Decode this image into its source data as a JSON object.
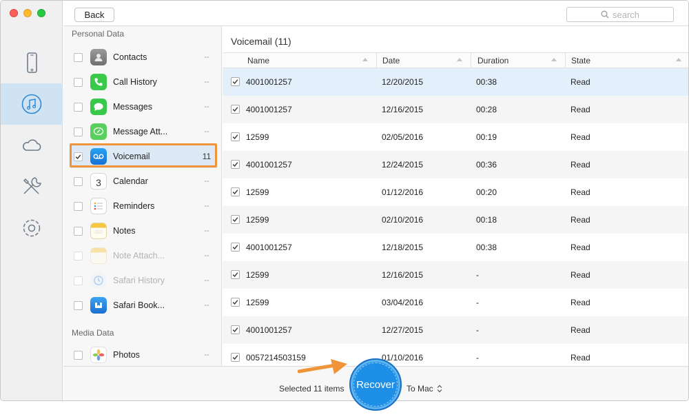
{
  "toolbar": {
    "back_label": "Back",
    "search_placeholder": "search"
  },
  "rail": {
    "items": [
      {
        "icon": "iphone-icon",
        "active": false
      },
      {
        "icon": "itunes-icon",
        "active": true
      },
      {
        "icon": "icloud-icon",
        "active": false
      },
      {
        "icon": "tools-icon",
        "active": false
      },
      {
        "icon": "gear-icon",
        "active": false
      }
    ]
  },
  "categories": {
    "personal_title": "Personal Data",
    "media_title": "Media Data",
    "items": [
      {
        "label": "Contacts",
        "count": "--",
        "icon": "contacts-icon"
      },
      {
        "label": "Call History",
        "count": "--",
        "icon": "phone-icon"
      },
      {
        "label": "Messages",
        "count": "--",
        "icon": "messages-icon"
      },
      {
        "label": "Message Att...",
        "count": "--",
        "icon": "attachment-icon"
      },
      {
        "label": "Voicemail",
        "count": "11",
        "icon": "voicemail-icon"
      },
      {
        "label": "Calendar",
        "count": "--",
        "icon": "calendar-icon",
        "day": "3"
      },
      {
        "label": "Reminders",
        "count": "--",
        "icon": "reminders-icon"
      },
      {
        "label": "Notes",
        "count": "--",
        "icon": "notes-icon"
      },
      {
        "label": "Note Attach...",
        "count": "--",
        "icon": "note-attachment-icon"
      },
      {
        "label": "Safari History",
        "count": "--",
        "icon": "safari-history-icon"
      },
      {
        "label": "Safari Book...",
        "count": "--",
        "icon": "safari-bookmark-icon"
      },
      {
        "label": "Photos",
        "count": "--",
        "icon": "photos-icon"
      }
    ]
  },
  "table": {
    "title": "Voicemail (11)",
    "columns": [
      "Name",
      "Date",
      "Duration",
      "State"
    ],
    "rows": [
      {
        "name": "4001001257",
        "date": "12/20/2015",
        "duration": "00:38",
        "state": "Read"
      },
      {
        "name": "4001001257",
        "date": "12/16/2015",
        "duration": "00:28",
        "state": "Read"
      },
      {
        "name": "12599",
        "date": "02/05/2016",
        "duration": "00:19",
        "state": "Read"
      },
      {
        "name": "4001001257",
        "date": "12/24/2015",
        "duration": "00:36",
        "state": "Read"
      },
      {
        "name": "12599",
        "date": "01/12/2016",
        "duration": "00:20",
        "state": "Read"
      },
      {
        "name": "12599",
        "date": "02/10/2016",
        "duration": "00:18",
        "state": "Read"
      },
      {
        "name": "4001001257",
        "date": "12/18/2015",
        "duration": "00:38",
        "state": "Read"
      },
      {
        "name": "12599",
        "date": "12/16/2015",
        "duration": "-",
        "state": "Read"
      },
      {
        "name": "12599",
        "date": "03/04/2016",
        "duration": "-",
        "state": "Read"
      },
      {
        "name": "4001001257",
        "date": "12/27/2015",
        "duration": "-",
        "state": "Read"
      },
      {
        "name": "0057214503159",
        "date": "01/10/2016",
        "duration": "-",
        "state": "Read"
      }
    ]
  },
  "footer": {
    "selected_text": "Selected 11 items",
    "recover_label": "Recover",
    "destination": "To Mac"
  },
  "colors": {
    "accent": "#1e8fe6",
    "highlight": "#f0943a",
    "selected_row": "#e3f0fb"
  }
}
